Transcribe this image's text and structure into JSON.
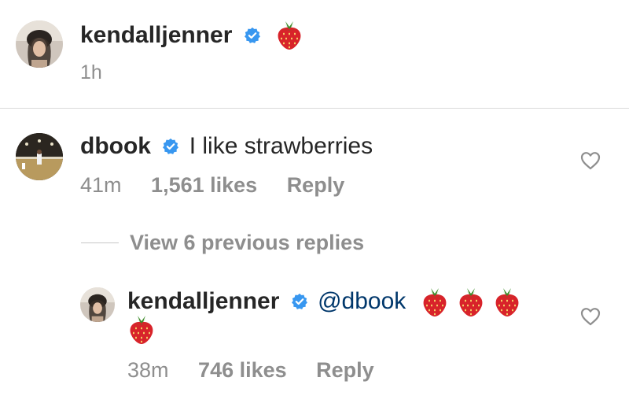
{
  "post": {
    "username": "kendalljenner",
    "time": "1h",
    "caption_emoji": "strawberry"
  },
  "comment": {
    "username": "dbook",
    "text": "I like strawberries",
    "time": "41m",
    "likes": "1,561 likes",
    "reply_label": "Reply"
  },
  "view_replies": "View 6 previous replies",
  "reply": {
    "username": "kendalljenner",
    "mention": "@dbook",
    "strawberries": 4,
    "time": "38m",
    "likes": "746 likes",
    "reply_label": "Reply"
  },
  "icons": {
    "verified": "verified-badge-icon",
    "heart": "heart-outline-icon",
    "emoji": "strawberry-emoji-icon"
  },
  "colors": {
    "verified_blue": "#3897f0",
    "mention_blue": "#00376b",
    "meta_gray": "#8e8e8e",
    "strawberry_red": "#d8232a"
  }
}
